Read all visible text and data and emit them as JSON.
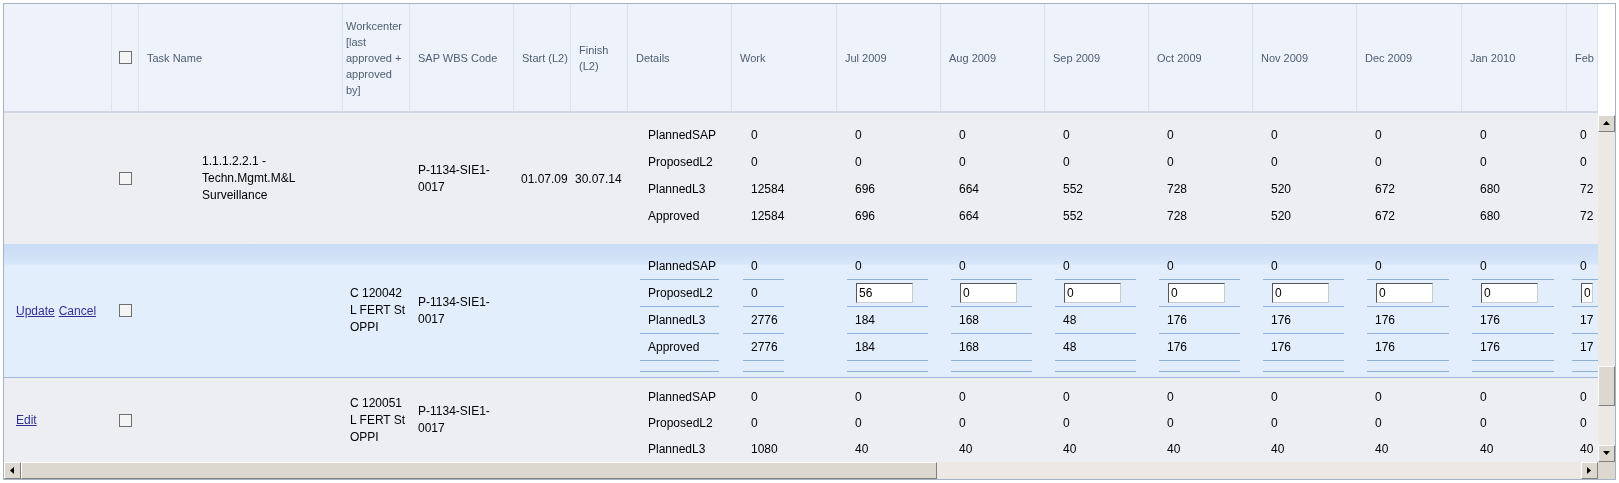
{
  "header": {
    "select_all_checked": false,
    "columns": [
      "Task Name",
      "Workcenter [last approved + approved by]",
      "SAP WBS Code",
      "Start (L2)",
      "Finish (L2)",
      "Details",
      "Work",
      "Jul 2009",
      "Aug 2009",
      "Sep 2009",
      "Oct 2009",
      "Nov 2009",
      "Dec 2009",
      "Jan 2010",
      "Feb"
    ]
  },
  "rows": [
    {
      "links": [],
      "checked": false,
      "editing": false,
      "task_name": "1.1.1.2.2.1 - Techn.Mgmt.M&L Surveillance",
      "workcenter": "",
      "wbs_code": "P-1134-SIE1-0017",
      "start": "01.07.09",
      "finish": "30.07.14",
      "lines": [
        {
          "kind": "text",
          "detail": "PlannedSAP",
          "work": "0",
          "months": [
            "0",
            "0",
            "0",
            "0",
            "0",
            "0",
            "0",
            "0"
          ]
        },
        {
          "kind": "text",
          "detail": "ProposedL2",
          "work": "0",
          "months": [
            "0",
            "0",
            "0",
            "0",
            "0",
            "0",
            "0",
            "0"
          ]
        },
        {
          "kind": "text",
          "detail": "PlannedL3",
          "work": "12584",
          "months": [
            "696",
            "664",
            "552",
            "728",
            "520",
            "672",
            "680",
            "72"
          ]
        },
        {
          "kind": "text",
          "detail": "Approved",
          "work": "12584",
          "months": [
            "696",
            "664",
            "552",
            "728",
            "520",
            "672",
            "680",
            "72"
          ]
        }
      ]
    },
    {
      "links": [
        "Update",
        "Cancel"
      ],
      "checked": false,
      "editing": true,
      "task_name": "",
      "workcenter": "C 120042 L FERT St OPPI",
      "wbs_code": "P-1134-SIE1-0017",
      "start": "",
      "finish": "",
      "lines": [
        {
          "kind": "text",
          "detail": "PlannedSAP",
          "work": "0",
          "months": [
            "0",
            "0",
            "0",
            "0",
            "0",
            "0",
            "0",
            "0"
          ]
        },
        {
          "kind": "input",
          "detail": "ProposedL2",
          "work": "0",
          "months": [
            "56",
            "0",
            "0",
            "0",
            "0",
            "0",
            "0",
            "0"
          ]
        },
        {
          "kind": "text",
          "detail": "PlannedL3",
          "work": "2776",
          "months": [
            "184",
            "168",
            "48",
            "176",
            "176",
            "176",
            "176",
            "17"
          ]
        },
        {
          "kind": "text",
          "detail": "Approved",
          "work": "2776",
          "months": [
            "184",
            "168",
            "48",
            "176",
            "176",
            "176",
            "176",
            "17"
          ]
        }
      ]
    },
    {
      "links": [
        "Edit"
      ],
      "checked": false,
      "editing": false,
      "task_name": "",
      "workcenter": "C 120051 L FERT St OPPI",
      "wbs_code": "P-1134-SIE1-0017",
      "start": "",
      "finish": "",
      "lines": [
        {
          "kind": "text",
          "detail": "PlannedSAP",
          "work": "0",
          "months": [
            "0",
            "0",
            "0",
            "0",
            "0",
            "0",
            "0",
            "0"
          ]
        },
        {
          "kind": "text",
          "detail": "ProposedL2",
          "work": "0",
          "months": [
            "0",
            "0",
            "0",
            "0",
            "0",
            "0",
            "0",
            "0"
          ]
        },
        {
          "kind": "text",
          "detail": "PlannedL3",
          "work": "1080",
          "months": [
            "40",
            "40",
            "40",
            "40",
            "40",
            "40",
            "40",
            "40"
          ]
        }
      ]
    }
  ]
}
